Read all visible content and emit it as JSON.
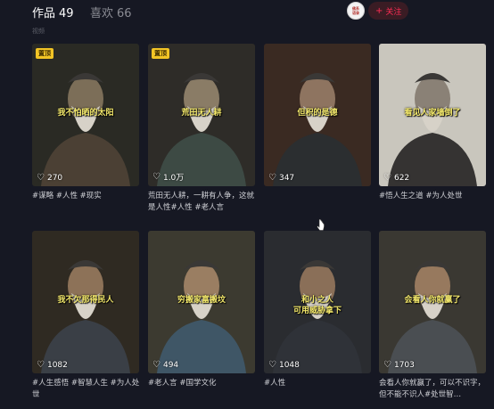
{
  "tabs": {
    "works_label": "作品",
    "works_count": "49",
    "likes_label": "喜欢",
    "likes_count": "66"
  },
  "account": {
    "avatar_line1": "佛系",
    "avatar_line2": "语录",
    "follow_label": "关注"
  },
  "section_label": "视频",
  "videos": [
    {
      "pinned": "置顶",
      "caption": "我不怕晒的太阳",
      "likes": "270",
      "desc": "#谋略 #人性 #现实"
    },
    {
      "pinned": "置顶",
      "caption": "荒田无人耕",
      "likes": "1.0万",
      "desc": "荒田无人耕，一耕有人争，这就是人性#人性 #老人言"
    },
    {
      "pinned": "",
      "caption": "但积的是德",
      "likes": "347",
      "desc": ""
    },
    {
      "pinned": "",
      "caption": "看见人家墙倒了",
      "likes": "622",
      "desc": "#悟人生之道 #为人处世"
    },
    {
      "pinned": "",
      "caption": "我不欠那得民人",
      "likes": "1082",
      "desc": "#人生感悟 #智慧人生 #为人处世"
    },
    {
      "pinned": "",
      "caption": "穷搬家富搬坟",
      "likes": "494",
      "desc": "#老人言 #国学文化"
    },
    {
      "pinned": "",
      "caption": "和小之人\n可用威胁拿下",
      "likes": "1048",
      "desc": "#人性"
    },
    {
      "pinned": "",
      "caption": "会看人你就赢了",
      "likes": "1703",
      "desc": "会看人你就赢了，可以不识字，但不能不识人#处世智…"
    }
  ],
  "colors": {
    "background": "#161823",
    "accent": "#fe2c55",
    "caption": "#f3e86b",
    "pin_badge": "#f2c425"
  },
  "icons": [
    "heart-icon",
    "plus-icon",
    "cursor-icon"
  ]
}
